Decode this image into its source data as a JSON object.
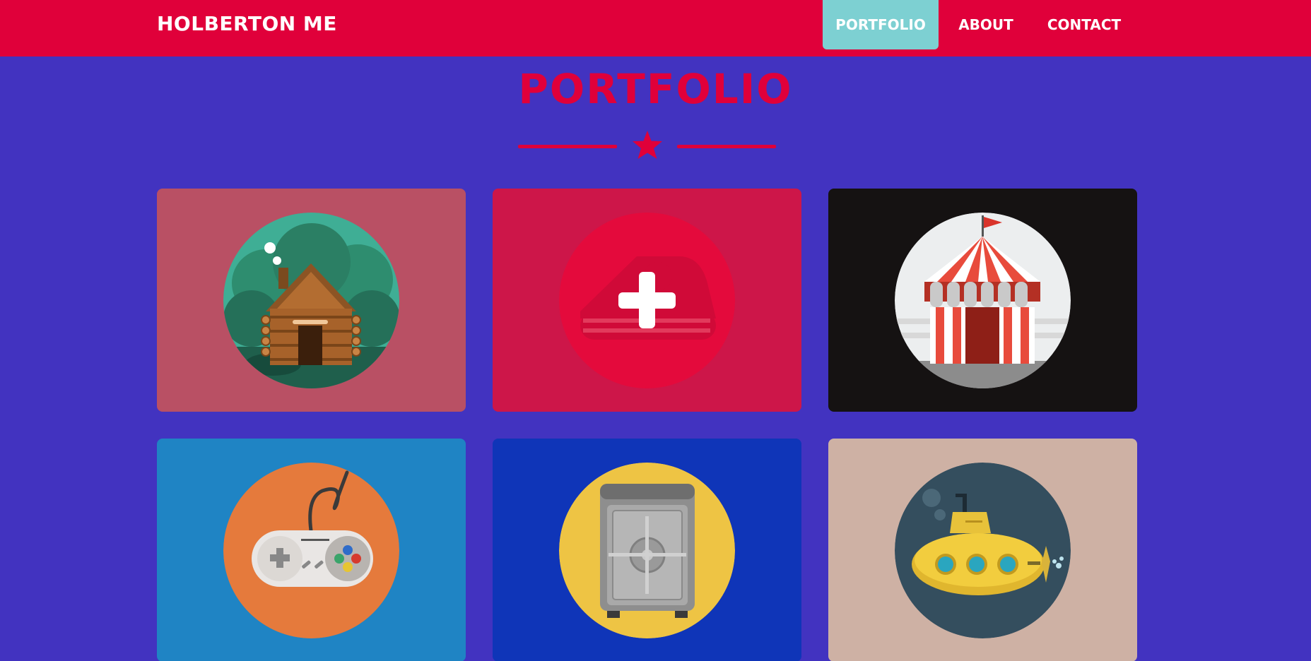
{
  "navbar": {
    "brand": "HOLBERTON ME",
    "items": [
      {
        "label": "PORTFOLIO",
        "active": true
      },
      {
        "label": "ABOUT",
        "active": false
      },
      {
        "label": "CONTACT",
        "active": false
      }
    ]
  },
  "section": {
    "title": "PORTFOLIO",
    "divider_icon": "star-icon"
  },
  "colors": {
    "page_background": "#4233c0",
    "navbar_background": "#e0003a",
    "active_nav": "#7dd0d2",
    "accent": "#e0003a"
  },
  "portfolio": {
    "cards": [
      {
        "icon": "log-cabin-icon",
        "card_color": "#b95064",
        "circle_color": "#3fae95"
      },
      {
        "icon": "add-project-plus-icon",
        "card_color": "#cd1649",
        "circle_color": "#e40a3c"
      },
      {
        "icon": "circus-tent-icon",
        "card_color": "#151212",
        "circle_color": "#eceeef"
      },
      {
        "icon": "game-controller-icon",
        "card_color": "#1f84c4",
        "circle_color": "#e57a3c"
      },
      {
        "icon": "safe-icon",
        "card_color": "#0f35b8",
        "circle_color": "#eec444"
      },
      {
        "icon": "submarine-icon",
        "card_color": "#ceb1a4",
        "circle_color": "#344e5e"
      }
    ]
  }
}
